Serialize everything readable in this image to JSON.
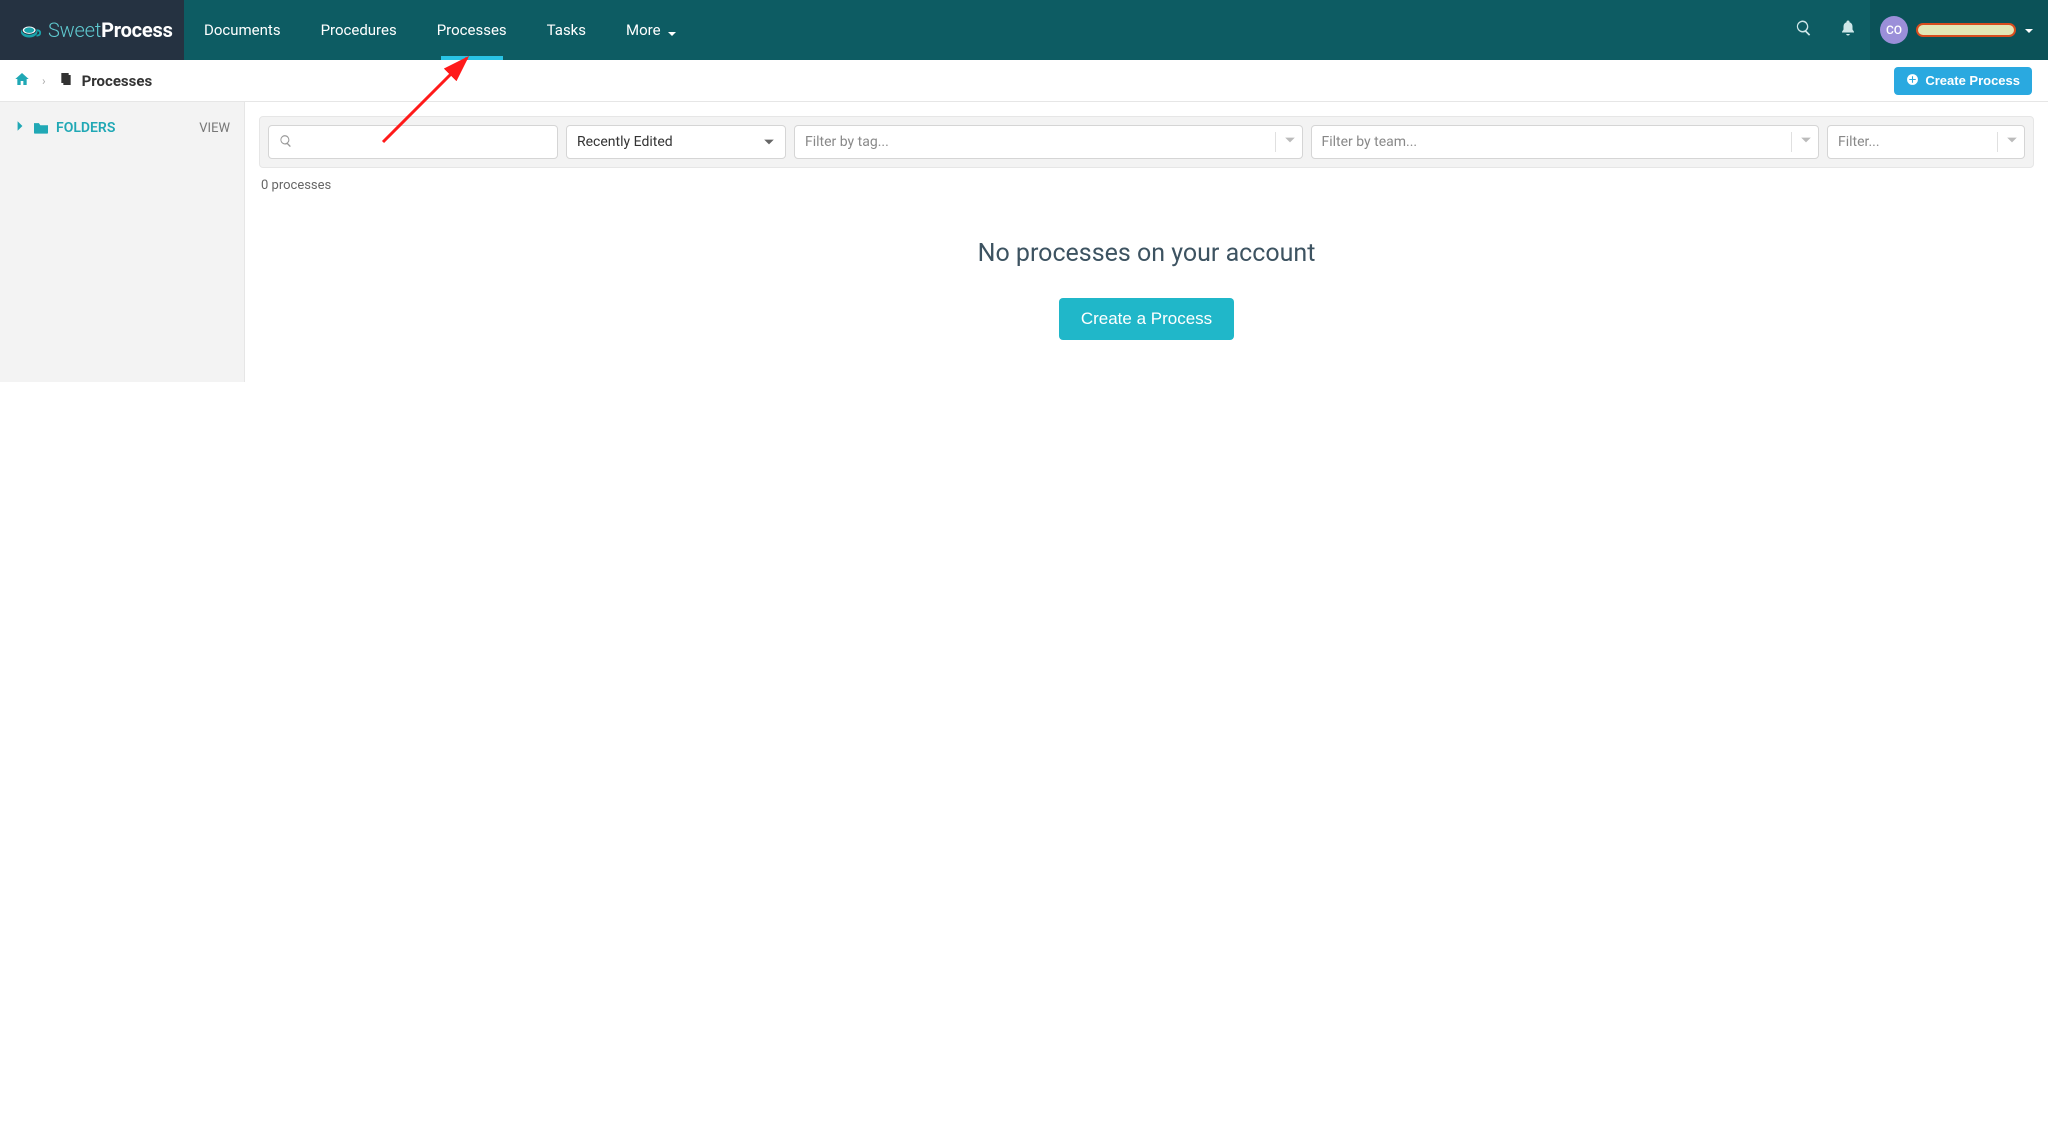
{
  "brand": {
    "first": "Sweet",
    "second": "Process"
  },
  "nav": {
    "documents": "Documents",
    "procedures": "Procedures",
    "processes": "Processes",
    "tasks": "Tasks",
    "more": "More"
  },
  "user": {
    "initials": "CO"
  },
  "breadcrumb": {
    "page": "Processes"
  },
  "actions": {
    "create_process": "Create Process"
  },
  "sidebar": {
    "folders": "FOLDERS",
    "view": "VIEW"
  },
  "filters": {
    "sort_value": "Recently Edited",
    "tag_placeholder": "Filter by tag...",
    "team_placeholder": "Filter by team...",
    "generic_placeholder": "Filter..."
  },
  "list": {
    "count_label": "0 processes",
    "empty_title": "No processes on your account",
    "cta": "Create a Process"
  },
  "icons": {
    "search": "search-icon",
    "bell": "bell-icon",
    "home": "home-icon",
    "folder": "folder-icon",
    "plus": "plus-icon"
  }
}
